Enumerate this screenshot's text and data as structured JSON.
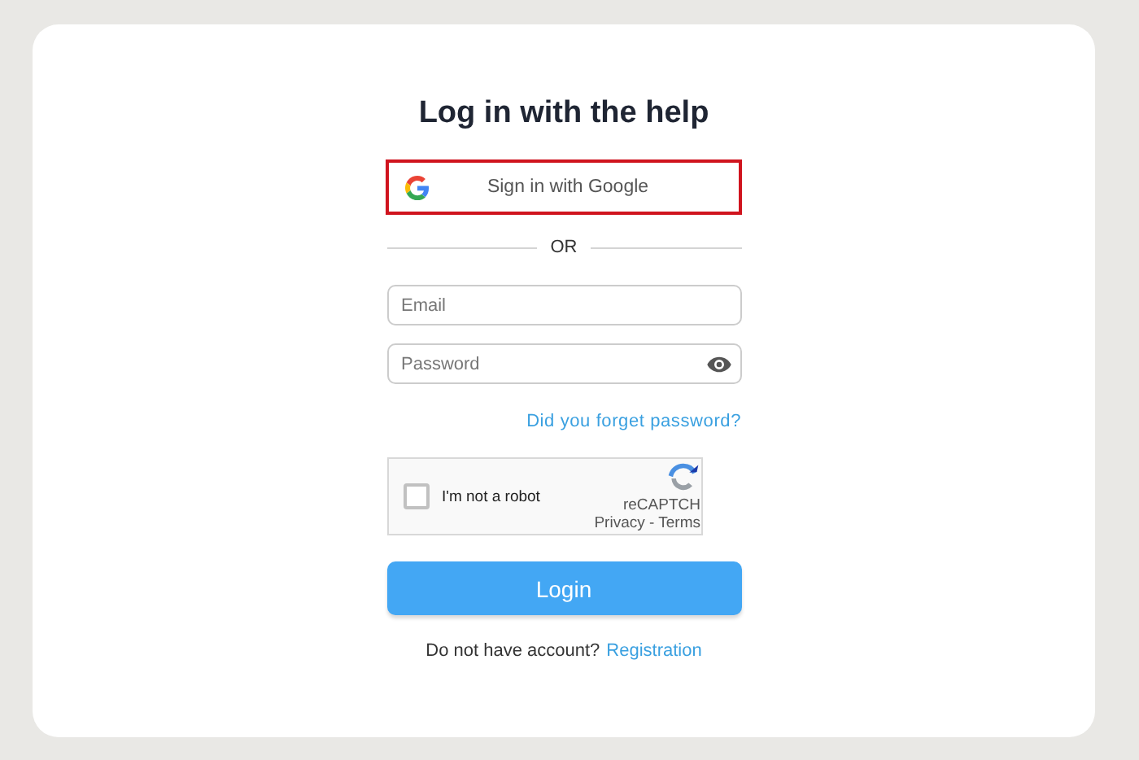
{
  "title": "Log in with the help",
  "google_button": {
    "label": "Sign in with Google",
    "highlighted": true
  },
  "divider": "OR",
  "email": {
    "placeholder": "Email"
  },
  "password": {
    "placeholder": "Password"
  },
  "forgot_link": "Did you forget password?",
  "captcha": {
    "label": "I'm not a robot",
    "checked": false,
    "brand_shown": "reCAPTCH",
    "links": "Privacy - Terms"
  },
  "login_button": "Login",
  "footer": {
    "text": "Do not have account?",
    "link": "Registration"
  }
}
